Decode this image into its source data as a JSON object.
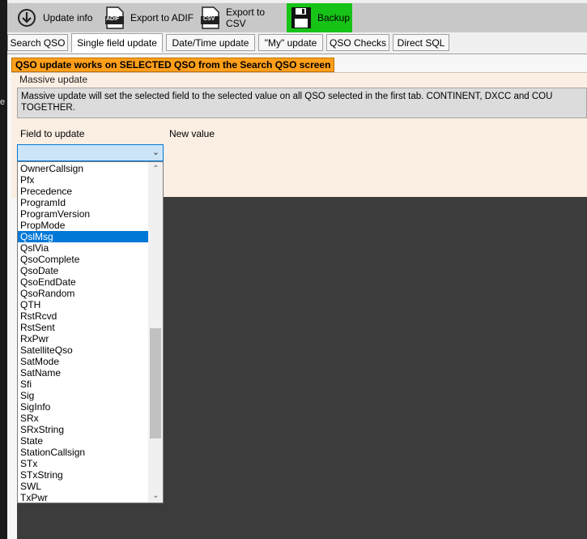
{
  "toolbar": {
    "update_info": "Update info",
    "export_adif": "Export to ADIF",
    "export_csv": "Export to CSV",
    "backup": "Backup",
    "adif_icon_text": "ADIF",
    "csv_icon_text": "CSV"
  },
  "tabs": [
    {
      "label": "Search QSO"
    },
    {
      "label": "Single field update"
    },
    {
      "label": "Date/Time update"
    },
    {
      "label": "\"My\" update"
    },
    {
      "label": "QSO Checks"
    },
    {
      "label": "Direct SQL"
    }
  ],
  "active_tab": "Single field update",
  "warning": "QSO update works on SELECTED QSO from the Search QSO screen",
  "group": {
    "title": "Massive update",
    "description": "Massive update will set the selected field to the selected value on all QSO selected in the first tab. CONTINENT, DXCC and COU\nTOGETHER.",
    "field_label": "Field to update",
    "new_value_label": "New value",
    "field_value": ""
  },
  "dropdown": {
    "items": [
      "OwnerCallsign",
      "Pfx",
      "Precedence",
      "ProgramId",
      "ProgramVersion",
      "PropMode",
      "QslMsg",
      "QslVia",
      "QsoComplete",
      "QsoDate",
      "QsoEndDate",
      "QsoRandom",
      "QTH",
      "RstRcvd",
      "RstSent",
      "RxPwr",
      "SatelliteQso",
      "SatMode",
      "SatName",
      "Sfi",
      "Sig",
      "SigInfo",
      "SRx",
      "SRxString",
      "State",
      "StationCallsign",
      "STx",
      "STxString",
      "SWL",
      "TxPwr"
    ],
    "selected": "QslMsg",
    "scroll_position": 0.75
  },
  "colors": {
    "warning_bg": "#ff9f1a",
    "backup_bg": "#16c316",
    "selection": "#0078d7"
  },
  "left_edge_glyph": "e"
}
